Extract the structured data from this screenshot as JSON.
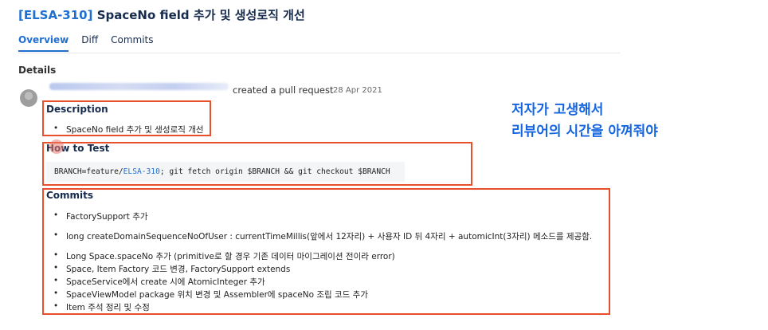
{
  "header": {
    "issue_key": "[ELSA-310]",
    "title": " SpaceNo field 추가 및 생성로직 개선"
  },
  "tabs": [
    {
      "label": "Overview",
      "active": true
    },
    {
      "label": "Diff",
      "active": false
    },
    {
      "label": "Commits",
      "active": false
    }
  ],
  "details": {
    "heading": "Details",
    "activity": "created a pull request",
    "date": "28 Apr 2021"
  },
  "description": {
    "title": "Description",
    "items": [
      "SpaceNo field 추가 및 생성로직 개선"
    ]
  },
  "how_to_test": {
    "title": "How to Test",
    "code_prefix": "BRANCH=feature/",
    "code_branch": "ELSA-310",
    "code_suffix": "; git fetch origin $BRANCH && git checkout $BRANCH"
  },
  "commits": {
    "title": "Commits",
    "items": [
      "FactorySupport 추가",
      "long createDomainSequenceNoOfUser : currentTimeMillis(앞에서 12자리) + 사용자 ID 뒤 4자리 + automicInt(3자리) 메소드를 제공함.",
      "Long Space.spaceNo 추가 (primitive로 할 경우 기존 데이터 마이그레이션 전이라 error)",
      "Space, Item Factory 코드 변경, FactorySupport extends",
      "SpaceService에서 create 시에 AtomicInteger 추가",
      "SpaceViewModel package 위치 변경 및 Assembler에 spaceNo 조립 코드 추가",
      "Item 주석 정리 및 수정"
    ]
  },
  "annotation": {
    "line1": "저자가 고생해서",
    "line2": "리뷰어의 시간을 아껴줘야"
  },
  "colors": {
    "link": "#1f6fd1",
    "highlight_box": "#e8502b",
    "annotation_text": "#1565e0"
  }
}
